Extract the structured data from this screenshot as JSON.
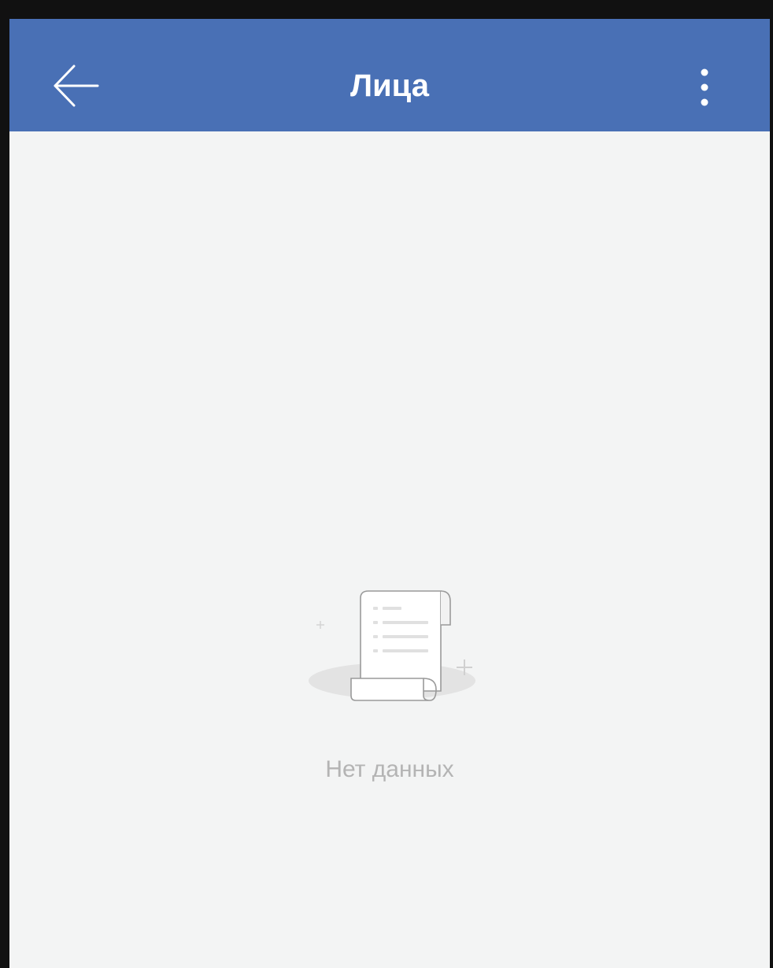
{
  "header": {
    "title": "Лица",
    "back_icon": "arrow-left-icon",
    "menu_icon": "more-vertical-icon"
  },
  "empty_state": {
    "icon": "document-scroll-icon",
    "message": "Нет данных"
  },
  "colors": {
    "appbar": "#4970b5",
    "background": "#f3f4f4",
    "empty_text": "#b4b4b4"
  }
}
